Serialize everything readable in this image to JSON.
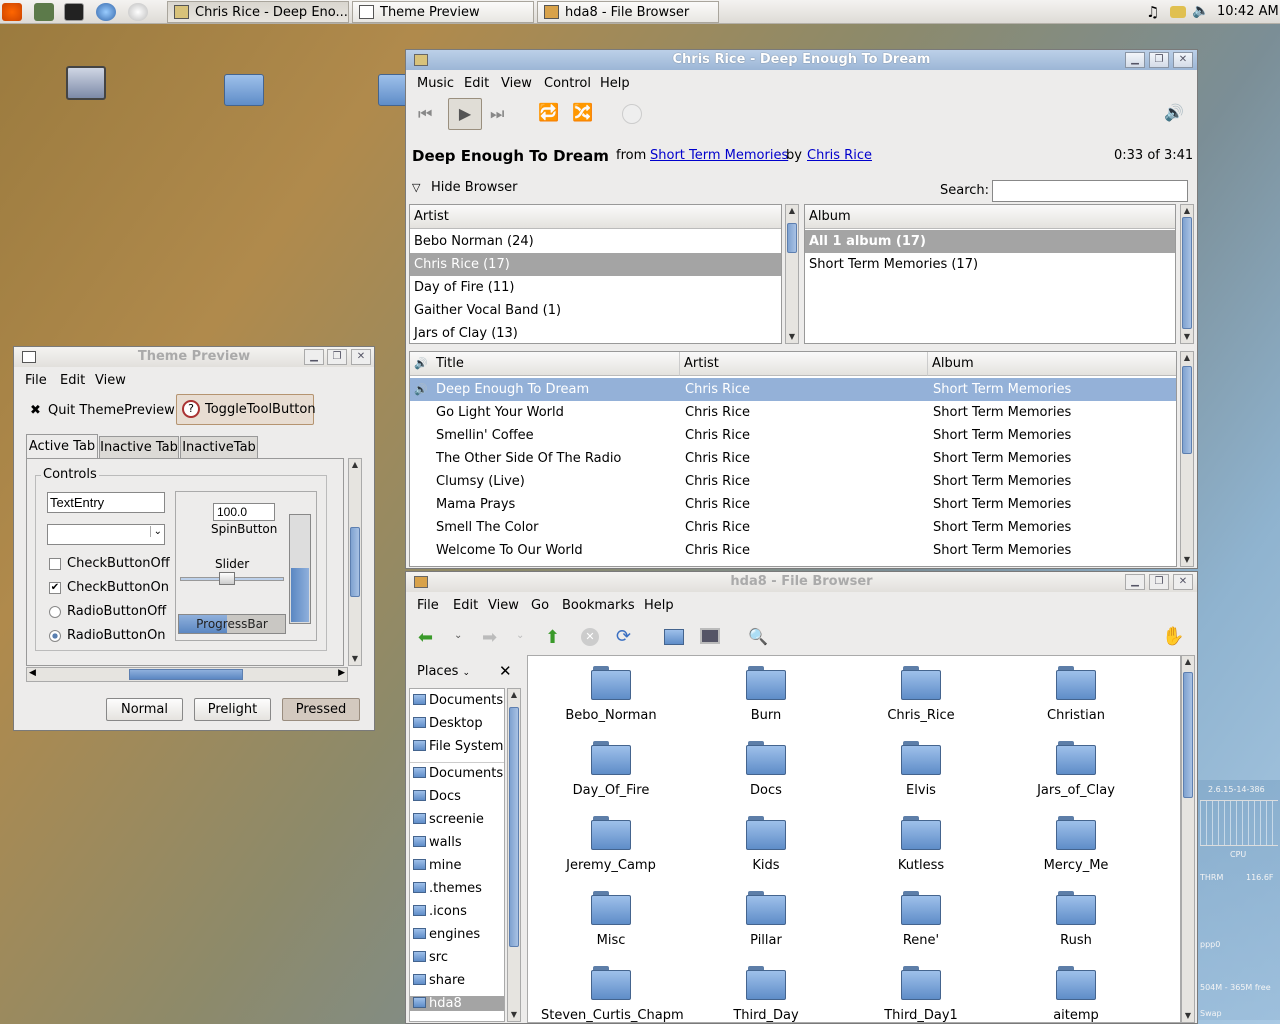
{
  "panel": {
    "tasks": [
      {
        "label": "Chris Rice - Deep Eno..."
      },
      {
        "label": "Theme Preview"
      },
      {
        "label": "hda8 - File Browser"
      }
    ],
    "clock": "10:42 AM"
  },
  "player": {
    "title": "Chris Rice - Deep Enough To Dream",
    "menu": [
      "Music",
      "Edit",
      "View",
      "Control",
      "Help"
    ],
    "song": "Deep Enough To Dream",
    "from_word": "from",
    "album_link": "Short Term Memories",
    "by_word": "by",
    "artist_link": "Chris Rice",
    "time": "0:33 of 3:41",
    "hide_browser": "Hide Browser",
    "search_label": "Search:",
    "search_value": "",
    "artist_header": "Artist",
    "album_header": "Album",
    "artists": [
      "Bebo Norman (24)",
      "Chris Rice (17)",
      "Day of Fire (11)",
      "Gaither Vocal Band (1)",
      "Jars of Clay (13)"
    ],
    "albums": [
      "All 1 album (17)",
      "Short Term Memories (17)"
    ],
    "track_headers": {
      "title": "Title",
      "artist": "Artist",
      "album": "Album"
    },
    "tracks": [
      {
        "title": "Deep Enough To Dream",
        "artist": "Chris Rice",
        "album": "Short Term Memories"
      },
      {
        "title": "Go Light Your World",
        "artist": "Chris Rice",
        "album": "Short Term Memories"
      },
      {
        "title": "Smellin' Coffee",
        "artist": "Chris Rice",
        "album": "Short Term Memories"
      },
      {
        "title": "The Other Side Of The Radio",
        "artist": "Chris Rice",
        "album": "Short Term Memories"
      },
      {
        "title": "Clumsy (Live)",
        "artist": "Chris Rice",
        "album": "Short Term Memories"
      },
      {
        "title": "Mama Prays",
        "artist": "Chris Rice",
        "album": "Short Term Memories"
      },
      {
        "title": "Smell The Color",
        "artist": "Chris Rice",
        "album": "Short Term Memories"
      },
      {
        "title": "Welcome To Our World",
        "artist": "Chris Rice",
        "album": "Short Term Memories"
      }
    ]
  },
  "theme": {
    "title": "Theme Preview",
    "menu": [
      "File",
      "Edit",
      "View"
    ],
    "quit": "Quit ThemePreview!",
    "toggle": "ToggleToolButton",
    "tabs": [
      "Active Tab",
      "Inactive Tab",
      "InactiveTab"
    ],
    "controls": "Controls",
    "entry": "TextEntry",
    "spin": "100.0",
    "spin_label": "SpinButton",
    "slider_label": "Slider",
    "slider_value": 0.45,
    "progress_label": "ProgressBar",
    "progress": 0.45,
    "check_off": "CheckButtonOff",
    "check_on": "CheckButtonOn",
    "radio_off": "RadioButtonOff",
    "radio_on": "RadioButtonOn",
    "buttons": [
      "Normal",
      "Prelight",
      "Pressed"
    ]
  },
  "files": {
    "title": "hda8 - File Browser",
    "menu": [
      "File",
      "Edit",
      "View",
      "Go",
      "Bookmarks",
      "Help"
    ],
    "places_label": "Places",
    "places": [
      "Documents",
      "Desktop",
      "File System",
      "Documents",
      "Docs",
      "screenie",
      "walls",
      "mine",
      ".themes",
      ".icons",
      "engines",
      "src",
      "share",
      "hda8"
    ],
    "folders": [
      "Bebo_Norman",
      "Burn",
      "Chris_Rice",
      "Christian",
      "Day_Of_Fire",
      "Docs",
      "Elvis",
      "Jars_of_Clay",
      "Jeremy_Camp",
      "Kids",
      "Kutless",
      "Mercy_Me",
      "Misc",
      "Pillar",
      "Rene'",
      "Rush",
      "Steven_Curtis_Chapm",
      "Third_Day",
      "Third_Day1",
      "aitemp"
    ]
  },
  "gkrellm": {
    "host": "2.6.15-14-386",
    "cpu": "CPU",
    "thrm": "THRM",
    "temp": "116.6F",
    "ppp": "ppp0",
    "swap": "Swap",
    "mem": "504M - 365M free"
  }
}
